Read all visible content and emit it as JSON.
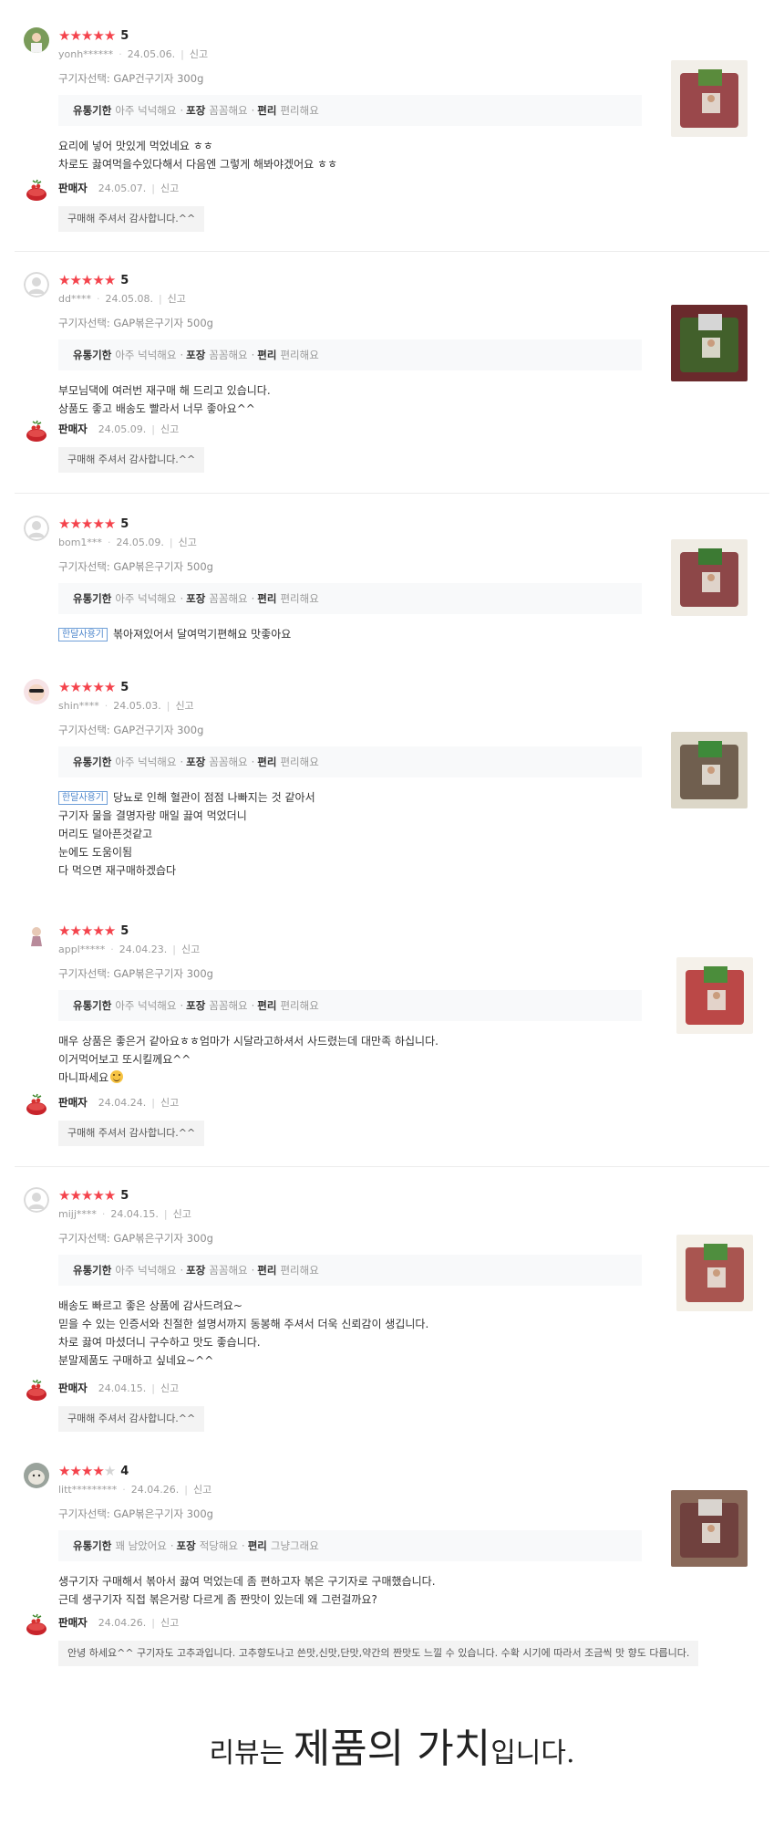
{
  "reviews": [
    {
      "rating": "5",
      "user": "yonh******",
      "date": "24.05.06.",
      "report": "신고",
      "option": "구기자선택: GAP건구기자 300g",
      "attrs": [
        {
          "k": "유통기한",
          "v": "아주 넉넉해요"
        },
        {
          "k": "포장",
          "v": "꼼꼼해요"
        },
        {
          "k": "편리",
          "v": "편리해요"
        }
      ],
      "badge": "",
      "lines": [
        "요리에 넣어 맛있게 먹었네요 ㅎㅎ",
        "차로도 끓여먹을수있다해서 다음엔 그렇게 해봐야겠어요 ㅎㅎ"
      ],
      "seller": {
        "name": "판매자",
        "date": "24.05.07.",
        "report": "신고",
        "reply": "구매해 주셔서 감사합니다.^^"
      }
    },
    {
      "rating": "5",
      "user": "dd****",
      "date": "24.05.08.",
      "report": "신고",
      "option": "구기자선택: GAP볶은구기자 500g",
      "attrs": [
        {
          "k": "유통기한",
          "v": "아주 넉넉해요"
        },
        {
          "k": "포장",
          "v": "꼼꼼해요"
        },
        {
          "k": "편리",
          "v": "편리해요"
        }
      ],
      "badge": "",
      "lines": [
        "부모님댁에 여러번 재구매 해 드리고 있습니다.",
        "상품도 좋고 배송도 빨라서 너무 좋아요^^"
      ],
      "seller": {
        "name": "판매자",
        "date": "24.05.09.",
        "report": "신고",
        "reply": "구매해 주셔서 감사합니다.^^"
      }
    },
    {
      "rating": "5",
      "user": "bom1***",
      "date": "24.05.09.",
      "report": "신고",
      "option": "구기자선택: GAP볶은구기자 500g",
      "attrs": [
        {
          "k": "유통기한",
          "v": "아주 넉넉해요"
        },
        {
          "k": "포장",
          "v": "꼼꼼해요"
        },
        {
          "k": "편리",
          "v": "편리해요"
        }
      ],
      "badge": "한달사용기",
      "lines": [
        "볶아져있어서 달여먹기편해요 맛좋아요"
      ],
      "seller": null
    },
    {
      "rating": "5",
      "user": "shin****",
      "date": "24.05.03.",
      "report": "신고",
      "option": "구기자선택: GAP건구기자 300g",
      "attrs": [
        {
          "k": "유통기한",
          "v": "아주 넉넉해요"
        },
        {
          "k": "포장",
          "v": "꼼꼼해요"
        },
        {
          "k": "편리",
          "v": "편리해요"
        }
      ],
      "badge": "한달사용기",
      "lines": [
        "당뇨로 인해 혈관이 점점 나빠지는 것 같아서",
        "구기자 물을 결명자랑 매일 끓여 먹었더니",
        "머리도 덜아픈것같고",
        "눈에도 도움이됨",
        "다 먹으면 재구매하겠습다"
      ],
      "seller": null
    },
    {
      "rating": "5",
      "user": "appl*****",
      "date": "24.04.23.",
      "report": "신고",
      "option": "구기자선택: GAP볶은구기자 300g",
      "attrs": [
        {
          "k": "유통기한",
          "v": "아주 넉넉해요"
        },
        {
          "k": "포장",
          "v": "꼼꼼해요"
        },
        {
          "k": "편리",
          "v": "편리해요"
        }
      ],
      "badge": "",
      "lines": [
        "매우 상품은 좋은거 같아요ㅎㅎ엄마가 시달라고하셔서 사드렸는데 대만족 하십니다.",
        "이거먹어보고 또시킬께요^^",
        "마니파세요"
      ],
      "seller": {
        "name": "판매자",
        "date": "24.04.24.",
        "report": "신고",
        "reply": "구매해 주셔서 감사합니다.^^"
      }
    },
    {
      "rating": "5",
      "user": "mijj****",
      "date": "24.04.15.",
      "report": "신고",
      "option": "구기자선택: GAP볶은구기자 300g",
      "attrs": [
        {
          "k": "유통기한",
          "v": "아주 넉넉해요"
        },
        {
          "k": "포장",
          "v": "꼼꼼해요"
        },
        {
          "k": "편리",
          "v": "편리해요"
        }
      ],
      "badge": "",
      "lines": [
        "배송도 빠르고 좋은 상품에 감사드려요~",
        "믿을 수 있는 인증서와 친절한 설명서까지 동봉해 주셔서 더욱 신뢰감이 생깁니다.",
        "차로 끓여 마셨더니 구수하고 맛도 좋습니다.",
        "분말제품도 구매하고 싶네요~^^"
      ],
      "seller": {
        "name": "판매자",
        "date": "24.04.15.",
        "report": "신고",
        "reply": "구매해 주셔서 감사합니다.^^"
      }
    },
    {
      "rating": "4",
      "user": "litt*********",
      "date": "24.04.26.",
      "report": "신고",
      "option": "구기자선택: GAP볶은구기자 300g",
      "attrs": [
        {
          "k": "유통기한",
          "v": "꽤 남았어요"
        },
        {
          "k": "포장",
          "v": "적당해요"
        },
        {
          "k": "편리",
          "v": "그냥그래요"
        }
      ],
      "badge": "",
      "lines": [
        "생구기자 구매해서  볶아서  끓여 먹었는데 좀 편하고자 볶은 구기자로 구매했습니다.",
        "근데 생구기자  직접 볶은거랑 다르게 좀 짠맛이 있는데  왜 그런걸까요?"
      ],
      "seller": {
        "name": "판매자",
        "date": "24.04.26.",
        "report": "신고",
        "reply": "안녕 하세요^^ 구기자도 고추과입니다. 고추향도나고 쓴맛,신맛,단맛,약간의 짠맛도 느낄 수 있습니다. 수확 시기에 따라서 조금씩 맛 향도 다릅니다."
      }
    }
  ],
  "footer": {
    "part1": "리뷰는 ",
    "part2": "제품의 가치",
    "part3": "입니다."
  },
  "colors": {
    "star_on": "#f4434c",
    "star_off": "#d4d4d4",
    "badge": "#4d86cc",
    "attr_bg": "#f8f9fa",
    "reply_bg": "#f3f3f3"
  }
}
